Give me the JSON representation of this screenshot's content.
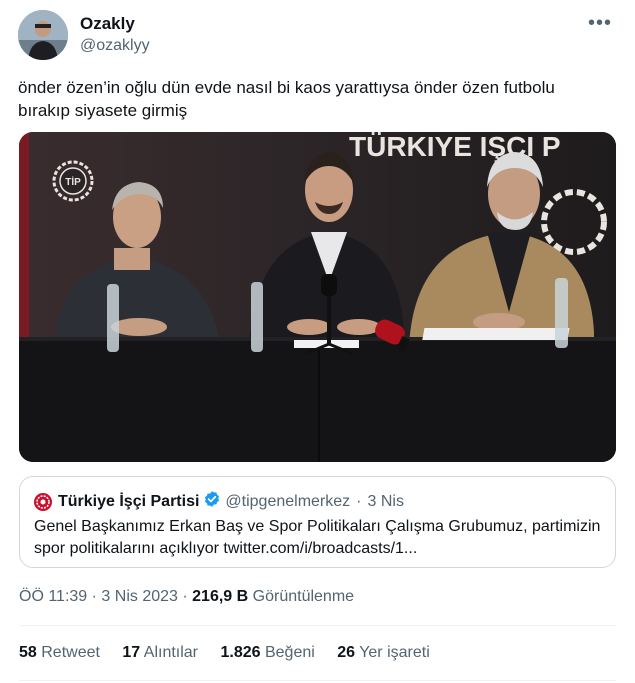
{
  "author": {
    "display_name": "Ozakly",
    "handle": "@ozaklyy",
    "avatar_icon": "user-avatar"
  },
  "more_icon": "ellipsis-icon",
  "tweet": {
    "text_line1": "önder özen’in oğlu dün evde nasıl bi kaos yarattıysa önder özen futbolu",
    "text_line2": "bırakıp siyasete girmiş"
  },
  "media": {
    "backdrop_text": "TÜRKIYE IŞÇI P",
    "logo_text": "TİP"
  },
  "quote": {
    "name": "Türkiye İşçi Partisi",
    "handle": "@tipgenelmerkez",
    "separator": "·",
    "date": "3 Nis",
    "body_line1": "Genel Başkanımız Erkan Baş ve Spor Politikaları Çalışma Grubumuz, partimizin",
    "body_line2": "spor politikalarını açıklıyor twitter.com/i/broadcasts/1...",
    "brand_color": "#c8102e",
    "verified_color": "#1d9bf0"
  },
  "meta": {
    "time": "ÖÖ 11:39",
    "sep1": "·",
    "date": "3 Nis 2023",
    "sep2": "·",
    "views": "216,9 B",
    "views_label": "Görüntülenme"
  },
  "stats": {
    "retweets": "58",
    "retweets_label": "Retweet",
    "quotes": "17",
    "quotes_label": "Alıntılar",
    "likes": "1.826",
    "likes_label": "Beğeni",
    "bookmarks": "26",
    "bookmarks_label": "Yer işareti"
  }
}
